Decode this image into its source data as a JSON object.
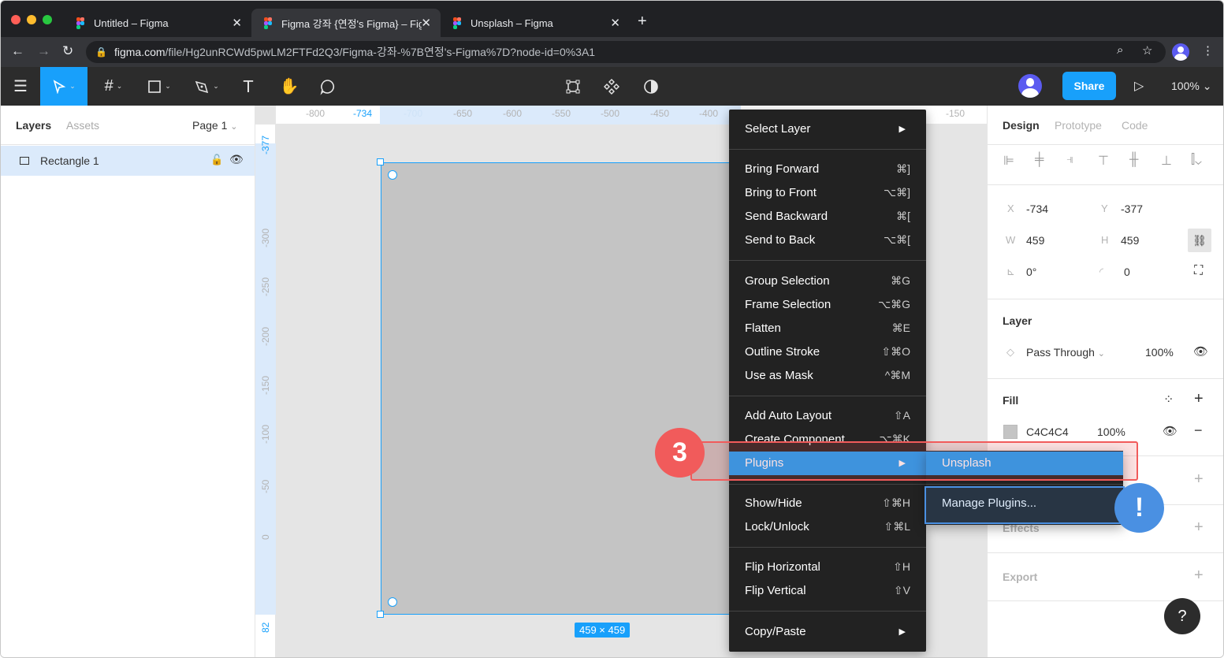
{
  "browser": {
    "tabs": [
      {
        "title": "Untitled – Figma"
      },
      {
        "title": "Figma 강좌 {연정's Figma} – Figma"
      },
      {
        "title": "Unsplash – Figma"
      }
    ],
    "url_host": "figma.com",
    "url_path": "/file/Hg2unRCWd5pwLM2FTFd2Q3/Figma-강좌-%7B연정's-Figma%7D?node-id=0%3A1"
  },
  "toolbar": {
    "share_label": "Share",
    "zoom": "100%"
  },
  "left_panel": {
    "tab_layers": "Layers",
    "tab_assets": "Assets",
    "page": "Page 1",
    "layers": [
      {
        "name": "Rectangle 1"
      }
    ]
  },
  "canvas": {
    "ruler_x": [
      "-800",
      "-734",
      "-700",
      "-650",
      "-600",
      "-550",
      "-500",
      "-450",
      "-400",
      "-150"
    ],
    "ruler_y": [
      "-377",
      "-300",
      "-250",
      "-200",
      "-150",
      "-100",
      "-50",
      "0",
      "82"
    ],
    "selection_size": "459 × 459",
    "rect_color": "#C4C4C4"
  },
  "context_menu": {
    "items": [
      {
        "label": "Select Layer",
        "shortcut": "",
        "submenu": true
      },
      {
        "label": "Bring Forward",
        "shortcut": "⌘]"
      },
      {
        "label": "Bring to Front",
        "shortcut": "⌥⌘]"
      },
      {
        "label": "Send Backward",
        "shortcut": "⌘["
      },
      {
        "label": "Send to Back",
        "shortcut": "⌥⌘["
      },
      {
        "label": "Group Selection",
        "shortcut": "⌘G"
      },
      {
        "label": "Frame Selection",
        "shortcut": "⌥⌘G"
      },
      {
        "label": "Flatten",
        "shortcut": "⌘E"
      },
      {
        "label": "Outline Stroke",
        "shortcut": "⇧⌘O"
      },
      {
        "label": "Use as Mask",
        "shortcut": "^⌘M"
      },
      {
        "label": "Add Auto Layout",
        "shortcut": "⇧A"
      },
      {
        "label": "Create Component",
        "shortcut": "⌥⌘K"
      },
      {
        "label": "Plugins",
        "shortcut": "",
        "submenu": true
      },
      {
        "label": "Show/Hide",
        "shortcut": "⇧⌘H"
      },
      {
        "label": "Lock/Unlock",
        "shortcut": "⇧⌘L"
      },
      {
        "label": "Flip Horizontal",
        "shortcut": "⇧H"
      },
      {
        "label": "Flip Vertical",
        "shortcut": "⇧V"
      },
      {
        "label": "Copy/Paste",
        "shortcut": "",
        "submenu": true
      }
    ],
    "plugins_submenu": [
      "Unsplash",
      "Manage Plugins..."
    ]
  },
  "annotations": {
    "step": "3",
    "alert": "!"
  },
  "right_panel": {
    "tabs": [
      "Design",
      "Prototype",
      "Code"
    ],
    "x_label": "X",
    "x": "-734",
    "y_label": "Y",
    "y": "-377",
    "w_label": "W",
    "w": "459",
    "h_label": "H",
    "h": "459",
    "rotation": "0°",
    "radius": "0",
    "layer_title": "Layer",
    "blend": "Pass Through",
    "opacity": "100%",
    "fill_title": "Fill",
    "fill_hex": "C4C4C4",
    "fill_opacity": "100%",
    "effects_title": "Effects",
    "export_title": "Export",
    "help": "?"
  },
  "colors": {
    "accent": "#18a0fb",
    "highlight_red": "#f15b5b",
    "highlight_blue": "#4a90e2"
  }
}
